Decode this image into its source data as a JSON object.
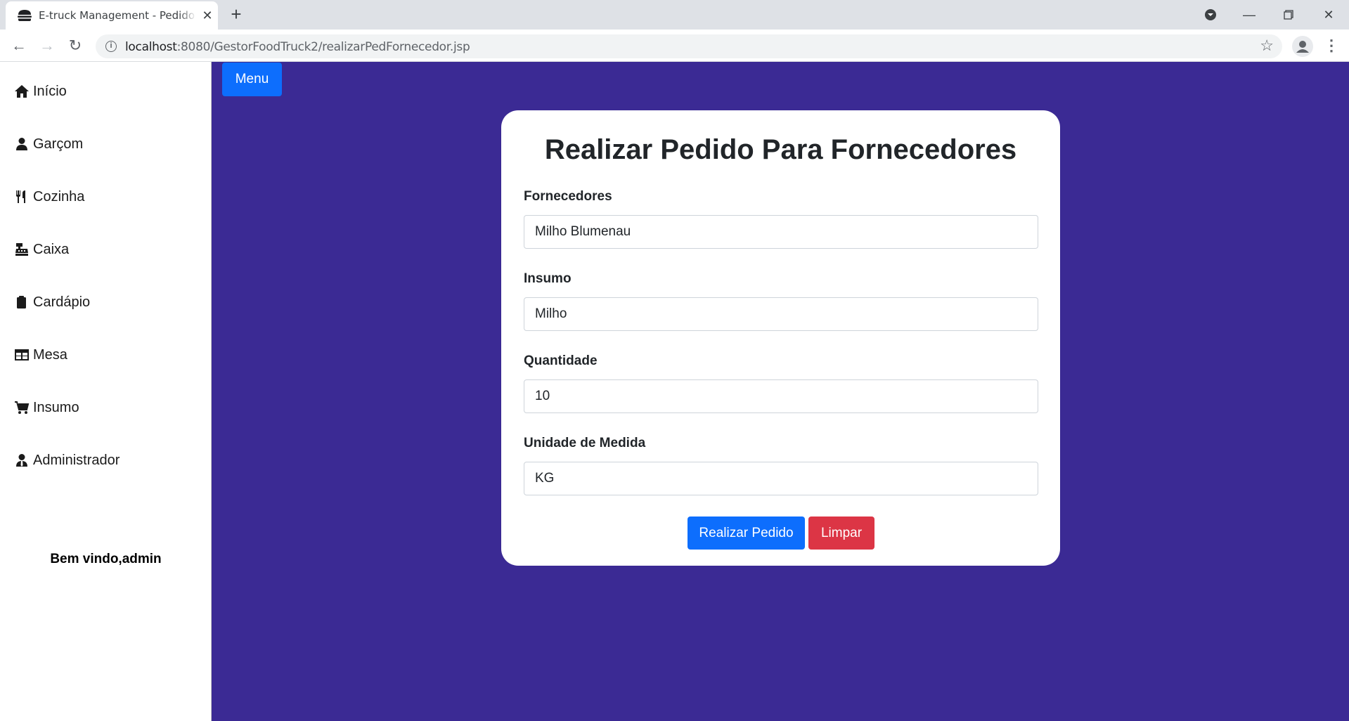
{
  "browser": {
    "tab_title": "E-truck Management - Pedido Para Fornecedores",
    "url_host": "localhost",
    "url_path": ":8080/GestorFoodTruck2/realizarPedFornecedor.jsp"
  },
  "sidebar": {
    "items": [
      {
        "label": "Início",
        "icon": "home-icon"
      },
      {
        "label": "Garçom",
        "icon": "user-icon"
      },
      {
        "label": "Cozinha",
        "icon": "utensils-icon"
      },
      {
        "label": "Caixa",
        "icon": "cash-register-icon"
      },
      {
        "label": "Cardápio",
        "icon": "clipboard-icon"
      },
      {
        "label": "Mesa",
        "icon": "table-icon"
      },
      {
        "label": "Insumo",
        "icon": "cart-icon"
      },
      {
        "label": "Administrador",
        "icon": "user-tie-icon"
      }
    ],
    "welcome": "Bem vindo,admin"
  },
  "main": {
    "menu_button": "Menu",
    "background_color": "#3b2a94",
    "form": {
      "title": "Realizar Pedido Para Fornecedores",
      "fields": [
        {
          "label": "Fornecedores",
          "value": "Milho Blumenau"
        },
        {
          "label": "Insumo",
          "value": "Milho"
        },
        {
          "label": "Quantidade",
          "value": "10"
        },
        {
          "label": "Unidade de Medida",
          "value": "KG"
        }
      ],
      "submit_label": "Realizar Pedido",
      "clear_label": "Limpar"
    }
  }
}
